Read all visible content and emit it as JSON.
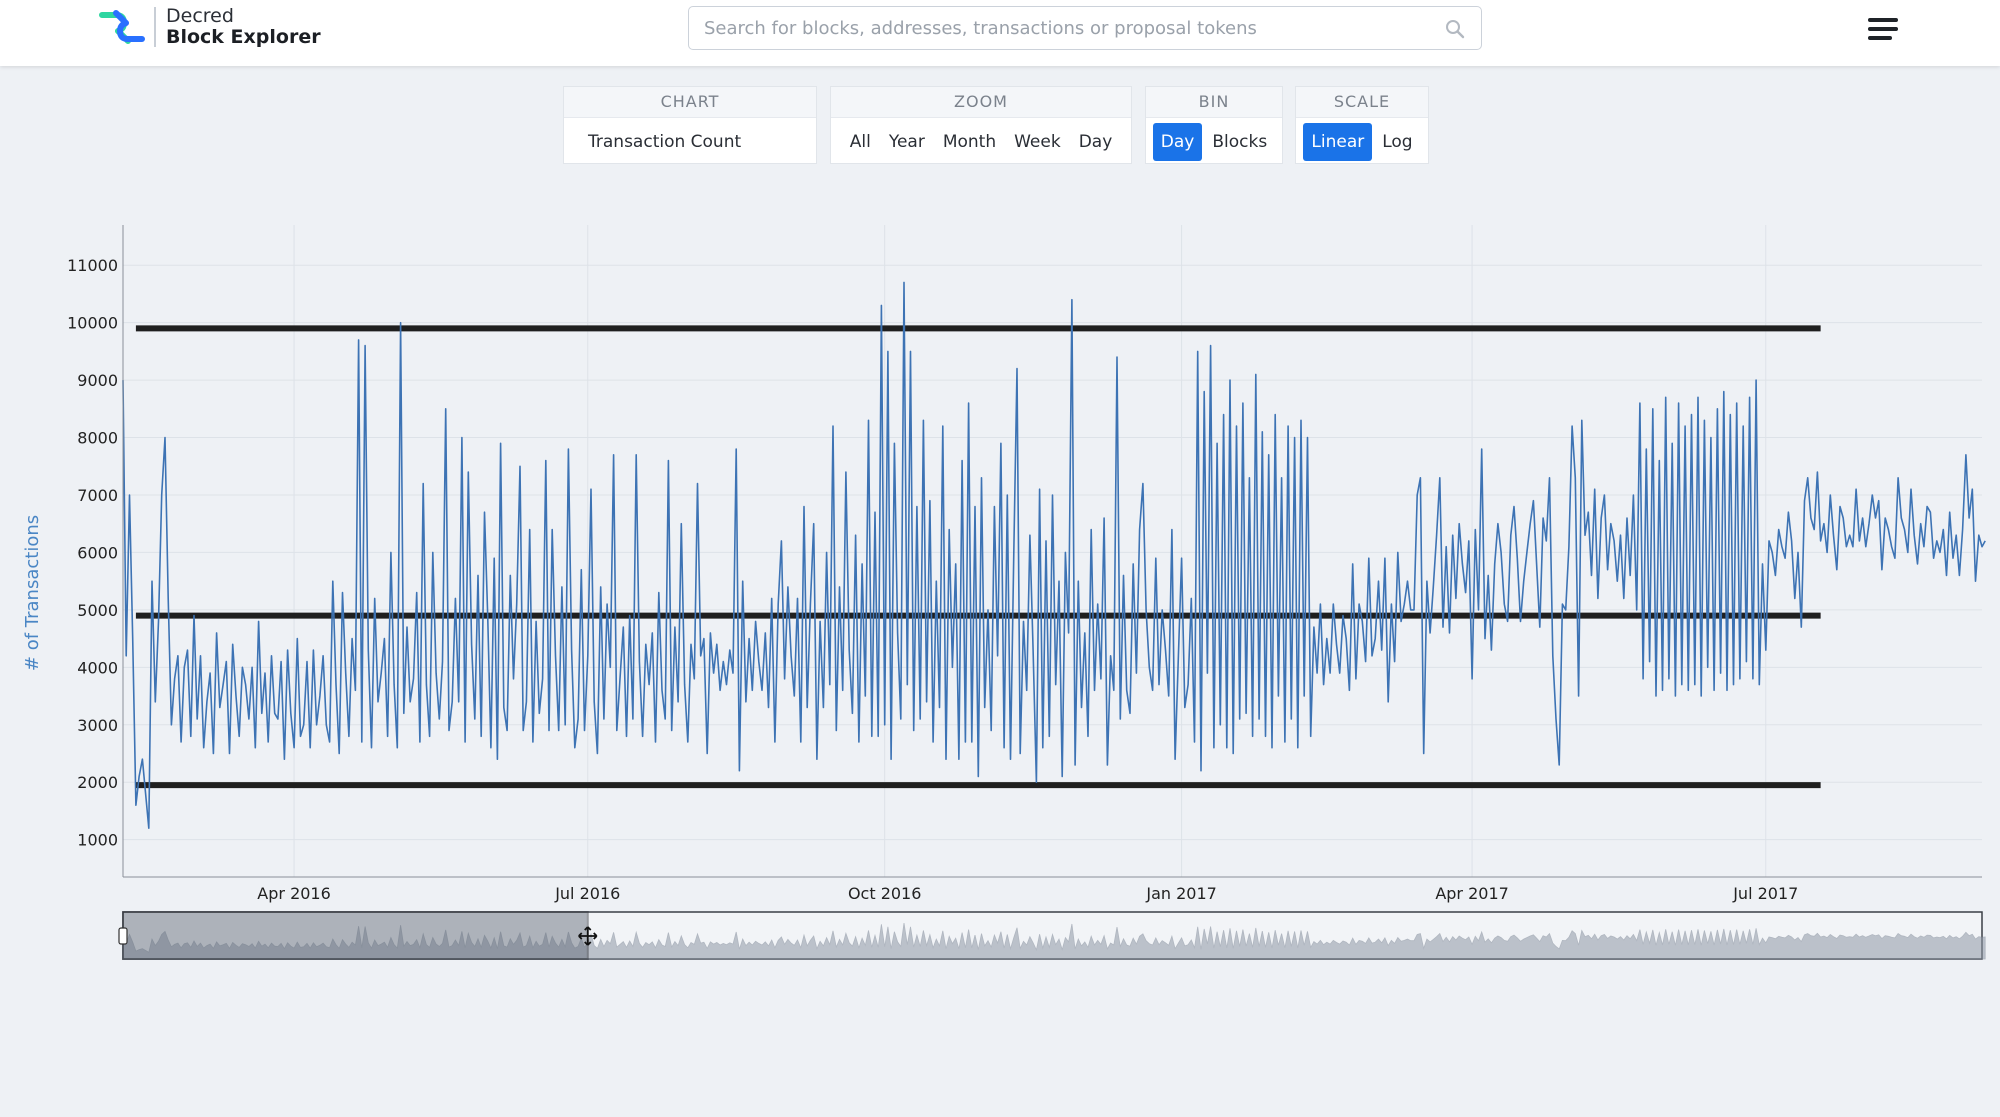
{
  "header": {
    "logo_line1": "Decred",
    "logo_line2": "Block Explorer",
    "search_placeholder": "Search for blocks, addresses, transactions or proposal tokens",
    "icons": {
      "search": "search-icon",
      "menu": "hamburger-menu-icon",
      "logo": "decred-logo-icon"
    }
  },
  "controls": {
    "chart": {
      "title": "CHART",
      "selected": "Transaction Count"
    },
    "zoom": {
      "title": "ZOOM",
      "options": [
        "All",
        "Year",
        "Month",
        "Week",
        "Day"
      ]
    },
    "bin": {
      "title": "BIN",
      "options": [
        "Day",
        "Blocks"
      ],
      "active": "Day"
    },
    "scale": {
      "title": "SCALE",
      "options": [
        "Linear",
        "Log"
      ],
      "active": "Linear"
    }
  },
  "colors": {
    "accent": "#1a73e8",
    "line": "#3d73b4",
    "reference_line": "#1f1f1f",
    "range_fill": "#8f98a6"
  },
  "chart_data": {
    "type": "line",
    "ylabel": "# of Transactions",
    "xlabel": "",
    "ylim": [
      350,
      11700
    ],
    "x_range": [
      "2016-02-08",
      "2017-09-06"
    ],
    "y_ticks": [
      1000,
      2000,
      3000,
      4000,
      5000,
      6000,
      7000,
      8000,
      9000,
      10000,
      11000
    ],
    "x_ticks": [
      {
        "date": "2016-04-01",
        "label": "Apr 2016"
      },
      {
        "date": "2016-07-01",
        "label": "Jul 2016"
      },
      {
        "date": "2016-10-01",
        "label": "Oct 2016"
      },
      {
        "date": "2017-01-01",
        "label": "Jan 2017"
      },
      {
        "date": "2017-04-01",
        "label": "Apr 2017"
      },
      {
        "date": "2017-07-01",
        "label": "Jul 2017"
      }
    ],
    "grid": true,
    "reference_lines": [
      {
        "y": 9900,
        "x_start": "2016-02-12",
        "x_end": "2017-07-18"
      },
      {
        "y": 4900,
        "x_start": "2016-02-12",
        "x_end": "2017-07-18"
      },
      {
        "y": 1950,
        "x_start": "2016-02-12",
        "x_end": "2017-07-18"
      }
    ],
    "series": [
      {
        "start_date": "2016-02-08",
        "step_days": 1,
        "values": [
          9000,
          4200,
          7000,
          4500,
          1600,
          2100,
          2400,
          1800,
          1200,
          5500,
          3400,
          4800,
          7000,
          8000,
          5200,
          3000,
          3800,
          4200,
          2700,
          4000,
          4300,
          2800,
          4900,
          3100,
          4200,
          2600,
          3400,
          3900,
          2500,
          4600,
          3300,
          3700,
          4100,
          2500,
          4400,
          3500,
          2800,
          4000,
          3700,
          3100,
          4000,
          2600,
          4800,
          3200,
          3900,
          2700,
          4200,
          3200,
          3100,
          4100,
          2400,
          4300,
          3200,
          2600,
          4500,
          2800,
          3000,
          4100,
          2600,
          4300,
          3000,
          3500,
          4200,
          3000,
          2700,
          5500,
          3700,
          2500,
          5300,
          3900,
          2800,
          4500,
          3600,
          9700,
          2700,
          9600,
          4300,
          2600,
          5200,
          3400,
          3900,
          4500,
          2800,
          6000,
          3700,
          2600,
          10000,
          3200,
          4700,
          3400,
          3800,
          5300,
          2700,
          7200,
          3700,
          2800,
          6000,
          3900,
          3100,
          4100,
          8500,
          2900,
          3400,
          5200,
          3400,
          8000,
          2700,
          7400,
          4400,
          3100,
          5600,
          2800,
          6700,
          4900,
          2600,
          5900,
          2400,
          7900,
          3300,
          2900,
          5600,
          3800,
          5100,
          7500,
          2900,
          3400,
          6400,
          2700,
          4800,
          3200,
          3800,
          7600,
          2900,
          6400,
          4200,
          2900,
          5400,
          3000,
          7800,
          4300,
          2600,
          3100,
          5700,
          2900,
          4200,
          7100,
          3400,
          2500,
          5400,
          3100,
          5100,
          4000,
          7700,
          2900,
          3800,
          4700,
          2800,
          4900,
          3100,
          7700,
          4100,
          2800,
          4400,
          3700,
          4600,
          2700,
          5300,
          3600,
          3100,
          7600,
          2900,
          4700,
          3400,
          6500,
          3700,
          2700,
          4400,
          3800,
          7200,
          4200,
          4500,
          2500,
          4600,
          3900,
          4400,
          3600,
          4100,
          3700,
          4300,
          3900,
          7800,
          2200,
          5500,
          3400,
          4500,
          3600,
          4800,
          4100,
          3600,
          4600,
          3300,
          5200,
          2700,
          5100,
          6200,
          3800,
          5400,
          4200,
          3500,
          5200,
          2700,
          6800,
          3300,
          5100,
          6500,
          2400,
          4800,
          3300,
          6000,
          3700,
          8200,
          2900,
          5400,
          3600,
          7400,
          4300,
          3200,
          6300,
          2700,
          5800,
          3500,
          8300,
          2800,
          6700,
          2800,
          10300,
          3000,
          9500,
          2400,
          7900,
          4600,
          3100,
          10700,
          3700,
          9500,
          2900,
          6800,
          3100,
          8300,
          3400,
          6900,
          2700,
          5500,
          3300,
          8200,
          2400,
          6400,
          4000,
          5800,
          2400,
          7600,
          2700,
          8600,
          2700,
          6800,
          2100,
          7300,
          3300,
          5000,
          2900,
          6800,
          4200,
          7900,
          2600,
          7000,
          2400,
          6000,
          9200,
          2500,
          4800,
          3600,
          6300,
          4300,
          2000,
          7100,
          2600,
          6200,
          2800,
          7000,
          3700,
          5500,
          2100,
          6000,
          4600,
          10400,
          2300,
          5500,
          3300,
          4600,
          2800,
          6400,
          3600,
          5100,
          3800,
          6600,
          2300,
          4200,
          3600,
          9400,
          3100,
          5600,
          3600,
          3200,
          5800,
          3900,
          6400,
          7200,
          5000,
          4000,
          3600,
          5900,
          3700,
          5000,
          4300,
          3500,
          6400,
          2400,
          4200,
          5900,
          3300,
          3700,
          5200,
          2700,
          9500,
          2200,
          8800,
          3900,
          9600,
          2600,
          7900,
          3000,
          8400,
          2600,
          9000,
          2500,
          8200,
          3100,
          8600,
          3200,
          7300,
          2800,
          9100,
          3100,
          8100,
          2800,
          7700,
          2600,
          8400,
          3500,
          7300,
          2700,
          8200,
          3100,
          8000,
          2600,
          8300,
          3500,
          8000,
          2800,
          4700,
          3900,
          5100,
          3700,
          4500,
          3900,
          5100,
          4400,
          3900,
          4900,
          4500,
          3600,
          5800,
          3800,
          5100,
          4800,
          4100,
          5900,
          4200,
          4500,
          5500,
          4300,
          5900,
          3400,
          5100,
          4100,
          6000,
          4800,
          5100,
          5500,
          5000,
          5000,
          7000,
          7300,
          2500,
          5500,
          4600,
          5400,
          6300,
          7300,
          4700,
          6100,
          4600,
          6300,
          5200,
          6500,
          5800,
          5300,
          6200,
          3800,
          6400,
          5000,
          7800,
          4500,
          5600,
          4300,
          5800,
          6500,
          6000,
          5100,
          4800,
          6300,
          6800,
          5900,
          4800,
          5500,
          6000,
          6500,
          6900,
          5800,
          4700,
          6600,
          6200,
          7300,
          4200,
          3100,
          2300,
          5100,
          5000,
          6100,
          8200,
          7300,
          3500,
          8300,
          6300,
          6700,
          5600,
          7100,
          5200,
          6600,
          7000,
          5700,
          6500,
          6200,
          5500,
          6300,
          5200,
          6600,
          5600,
          7000,
          5000,
          8600,
          3800,
          7800,
          4100,
          8500,
          3500,
          7600,
          3600,
          8700,
          3800,
          7900,
          3500,
          8600,
          3700,
          8200,
          3600,
          8400,
          3700,
          8700,
          3500,
          8300,
          4000,
          8000,
          3600,
          8500,
          3900,
          8800,
          3600,
          8400,
          3700,
          8600,
          3800,
          8200,
          4100,
          8700,
          3800,
          9000,
          3700,
          5800,
          4300,
          6200,
          6000,
          5600,
          6400,
          6100,
          5900,
          6700,
          6200,
          5200,
          6000,
          4700,
          6900,
          7300,
          6600,
          6400,
          7400,
          6200,
          6500,
          6000,
          7000,
          6300,
          5700,
          6800,
          6600,
          6100,
          6300,
          6100,
          7100,
          6200,
          6600,
          6100,
          6500,
          7000,
          6600,
          6900,
          5700,
          6600,
          6400,
          6100,
          5900,
          7300,
          6600,
          6400,
          6000,
          7100,
          6300,
          5800,
          6500,
          6100,
          6800,
          6700,
          5900,
          6200,
          6000,
          6400,
          5600,
          6700,
          5900,
          6300,
          5600,
          6400,
          7700,
          6600,
          7100,
          5500,
          6300,
          6100,
          6200
        ]
      }
    ],
    "range_selector": {
      "start": "2016-02-08",
      "end": "2016-07-01"
    }
  }
}
